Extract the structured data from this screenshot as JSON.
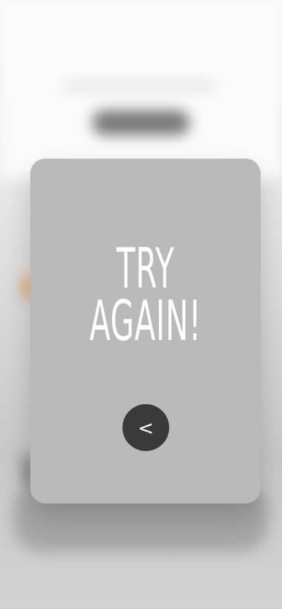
{
  "dialog": {
    "line1": "TRY",
    "line2": "AGAIN!",
    "back_label": "<"
  },
  "colors": {
    "card": "#b9b9b9",
    "button": "#3a3a3a",
    "accent_orange": "#e08a2a"
  }
}
